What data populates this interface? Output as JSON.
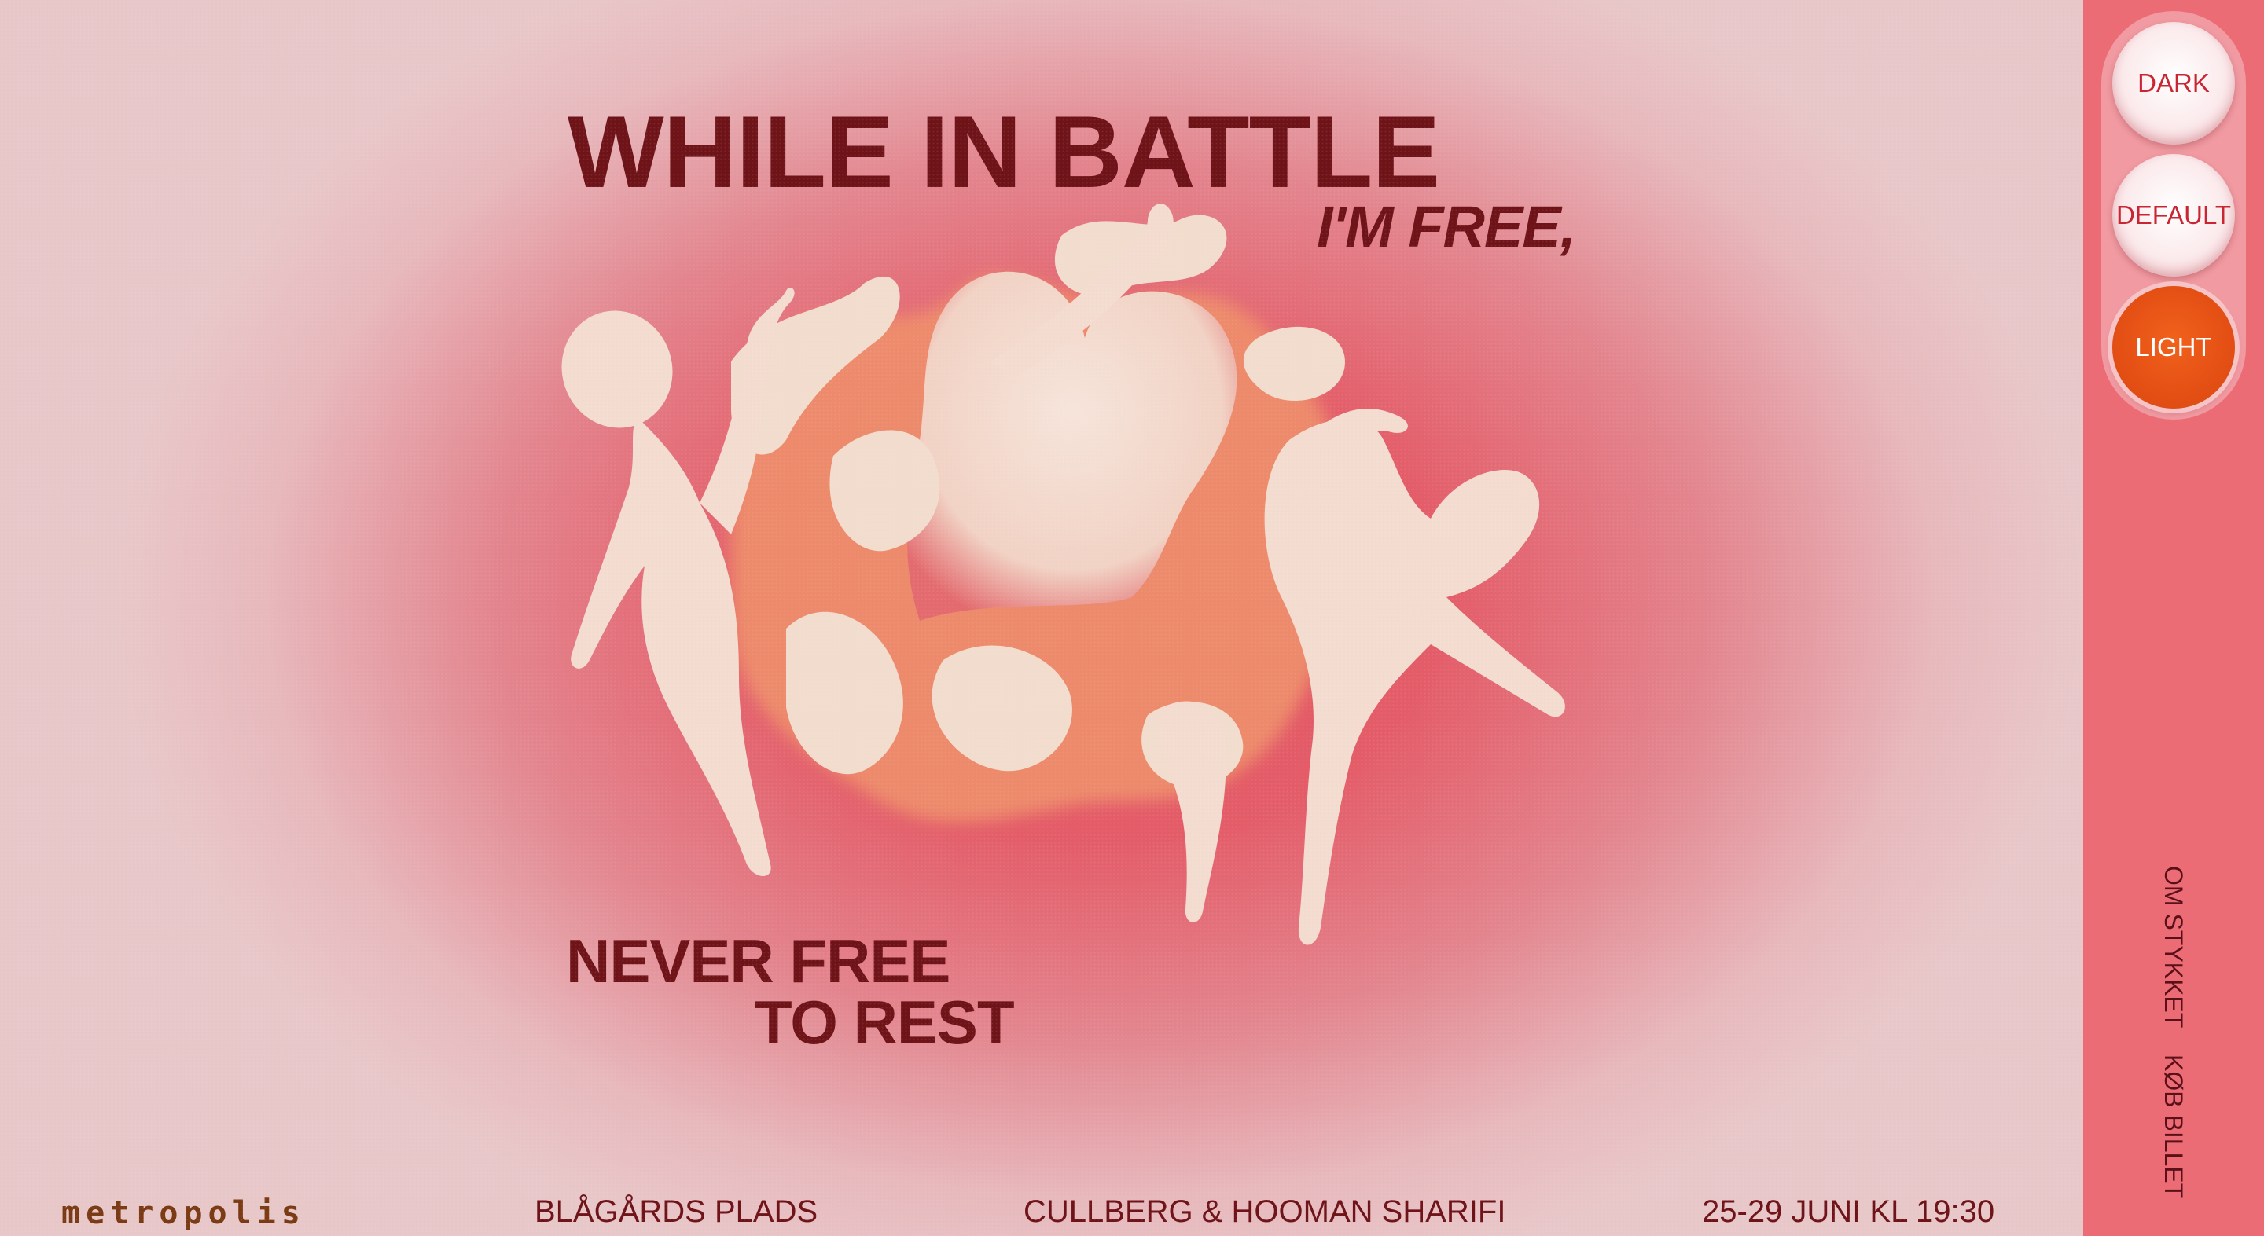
{
  "hero": {
    "title_main": "WHILE IN BATTLE",
    "title_sub": "I'M FREE,",
    "tagline_line1": "NEVER FREE",
    "tagline_line2": "TO REST"
  },
  "footer": {
    "logo": "metropolis",
    "venue": "BLÅGÅRDS PLADS",
    "credits": "CULLBERG & HOOMAN SHARIFI",
    "dates": "25-29 JUNI KL 19:30"
  },
  "sidebar": {
    "theme_options": [
      {
        "label": "DARK",
        "selected": false
      },
      {
        "label": "DEFAULT",
        "selected": false
      },
      {
        "label": "LIGHT",
        "selected": true
      }
    ],
    "nav": {
      "about_label": "OM STYKKET",
      "buy_label": "KØB BILLET"
    }
  },
  "colors": {
    "headline": "#6e1318",
    "sidebar_bg": "#ec6c76",
    "selected_theme": "#e44f14",
    "figure_fill": "#f3dccf",
    "accent_orange": "#ee8d6c"
  }
}
